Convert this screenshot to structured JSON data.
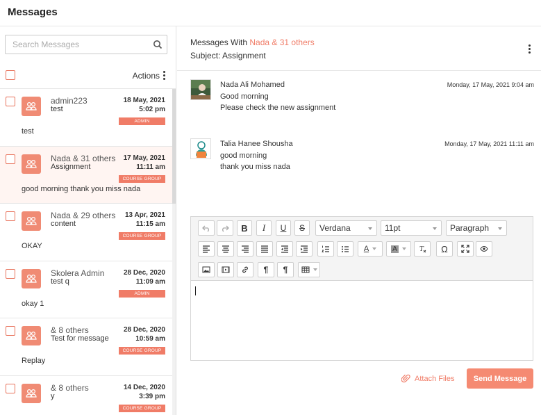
{
  "header": {
    "title": "Messages"
  },
  "search": {
    "placeholder": "Search Messages"
  },
  "list_header": {
    "actions_label": "Actions"
  },
  "messages": [
    {
      "sender": "admin223",
      "subject": "test",
      "date": "18 May, 2021",
      "time": "5:02 pm",
      "badge": "ADMIN",
      "preview": "test"
    },
    {
      "sender": "Nada & 31 others",
      "subject": "Assignment",
      "date": "17 May, 2021",
      "time": "11:11 am",
      "badge": "COURSE GROUP",
      "preview": "good morning thank you miss nada"
    },
    {
      "sender": "Nada & 29 others",
      "subject": "content",
      "date": "13 Apr, 2021",
      "time": "11:15 am",
      "badge": "COURSE GROUP",
      "preview": "OKAY"
    },
    {
      "sender": "Skolera Admin",
      "subject": "test q",
      "date": "28 Dec, 2020",
      "time": "11:09 am",
      "badge": "ADMIN",
      "preview": "okay 1"
    },
    {
      "sender": "& 8 others",
      "subject": "Test for message",
      "date": "28 Dec, 2020",
      "time": "10:59 am",
      "badge": "COURSE GROUP",
      "preview": "Replay"
    },
    {
      "sender": "& 8 others",
      "subject": "y",
      "date": "14 Dec, 2020",
      "time": "3:39 pm",
      "badge": "COURSE GROUP",
      "preview": ""
    }
  ],
  "thread": {
    "with_label": "Messages With ",
    "with_name": "Nada & 31 others",
    "subject_line": "Subject: Assignment",
    "entries": [
      {
        "name": "Nada Ali Mohamed",
        "timestamp": "Monday, 17 May, 2021 9:04 am",
        "lines": [
          "Good morning",
          "Please check the new assignment"
        ]
      },
      {
        "name": "Talia Hanee Shousha",
        "timestamp": "Monday, 17 May, 2021 11:11 am",
        "lines": [
          "good morning",
          "thank you miss nada"
        ]
      }
    ]
  },
  "editor": {
    "font_family": "Verdana",
    "font_size": "11pt",
    "block_format": "Paragraph",
    "bold_glyph": "B",
    "italic_glyph": "I",
    "underline_glyph": "U",
    "strike_glyph": "S",
    "text_color_glyph": "A",
    "bg_color_glyph": "A",
    "omega_glyph": "Ω",
    "pilcrow_glyph": "¶"
  },
  "compose": {
    "attach_label": "Attach Files",
    "send_label": "Send Message"
  },
  "colors": {
    "accent": "#f07c67",
    "badge": "#f07c67",
    "send_button": "#f58a72",
    "active_row": "#fff5f2"
  }
}
